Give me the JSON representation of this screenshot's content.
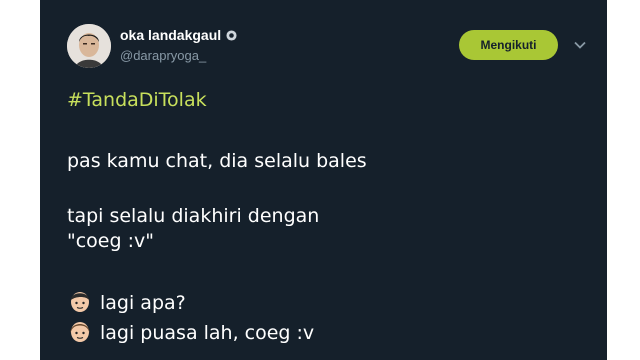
{
  "user": {
    "display_name": "oka landakgaul",
    "handle": "@darapryoga_",
    "avatar_icon": "person-avatar-icon",
    "verified_icon": "badge-icon"
  },
  "follow_button": {
    "label": "Mengikuti"
  },
  "menu": {
    "icon": "chevron-down-icon"
  },
  "tweet": {
    "hashtag": "#TandaDiTolak",
    "line1": "pas kamu chat, dia selalu bales",
    "line2": "tapi selalu diakhiri dengan",
    "line3": "\"coeg :v\"",
    "dialogue": [
      {
        "icon": "boy-face-emoji",
        "text": "lagi apa?"
      },
      {
        "icon": "girl-face-emoji",
        "text": "lagi puasa lah, coeg :v"
      }
    ]
  },
  "colors": {
    "background": "#15202b",
    "hashtag": "#c8e05c",
    "follow_button": "#a9c735",
    "handle": "#8899a6"
  }
}
